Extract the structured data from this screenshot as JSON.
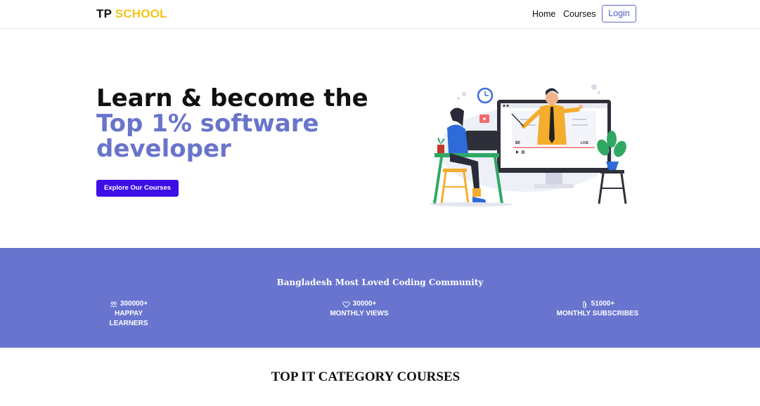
{
  "navbar": {
    "brand_part1": "TP",
    "brand_part2": "SCHOOL",
    "links": [
      "Home",
      "Courses"
    ],
    "login_label": "Login"
  },
  "hero": {
    "line1": "Learn & become the",
    "line2": "Top 1% software",
    "line3": "developer",
    "cta_label": "Explore Our Courses",
    "illustration": {
      "likes_count": "80",
      "live_label": "LIVE"
    }
  },
  "stats": {
    "title": "Bangladesh Most Loved Coding Community",
    "items": [
      {
        "icon": "people-icon",
        "number": "300000+",
        "label": "HAPPAY LEARNERS"
      },
      {
        "icon": "heart-icon",
        "number": "30000+",
        "label": "MONTHLY VIEWS"
      },
      {
        "icon": "paperclip-icon",
        "number": "51000+",
        "label": "MONTHLY SUBSCRIBES"
      }
    ]
  },
  "courses_section": {
    "title": "TOP IT CATEGORY COURSES"
  },
  "colors": {
    "accent": "#6874cd",
    "brand_yellow": "#f5c518",
    "cta": "#3d0ee6"
  }
}
